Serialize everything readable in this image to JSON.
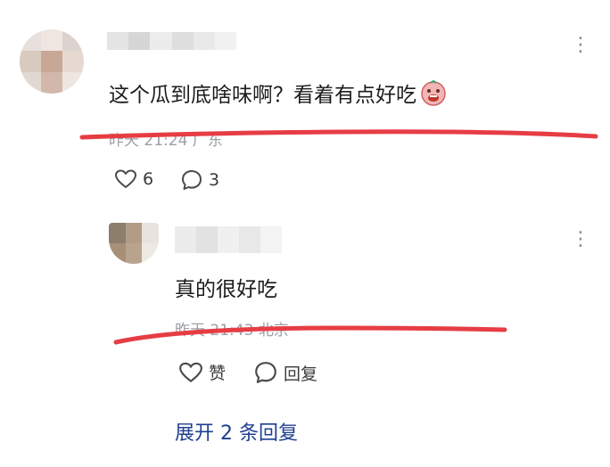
{
  "comments": [
    {
      "text": "这个瓜到底啥味啊？看着有点好吃",
      "meta": "昨天 21:24 广东",
      "likes": "6",
      "replies": "3",
      "avatar_colors": [
        "#e8e0dc",
        "#efe6e1",
        "#dcd3cf",
        "#d9c9bf",
        "#c8a797",
        "#e6d9d2",
        "#e2d8d2",
        "#d1b8aa",
        "#eee6e1"
      ]
    },
    {
      "text": "真的很好吃",
      "meta": "昨天 21:43 北京",
      "like_label": "赞",
      "reply_label": "回复",
      "avatar_colors": [
        "#8d7d6c",
        "#b39c86",
        "#e8e3de",
        "#a88f78",
        "#b8a38d",
        "#efe9e4"
      ]
    }
  ],
  "expand_label": "展开 2 条回复",
  "colors": {
    "annotation_red": "#e63d44",
    "link_blue": "#1f3f8f",
    "meta_gray": "#9aa0a6"
  },
  "icons": {
    "more": "more-icon",
    "like": "heart-icon",
    "comment": "comment-bubble-icon"
  }
}
